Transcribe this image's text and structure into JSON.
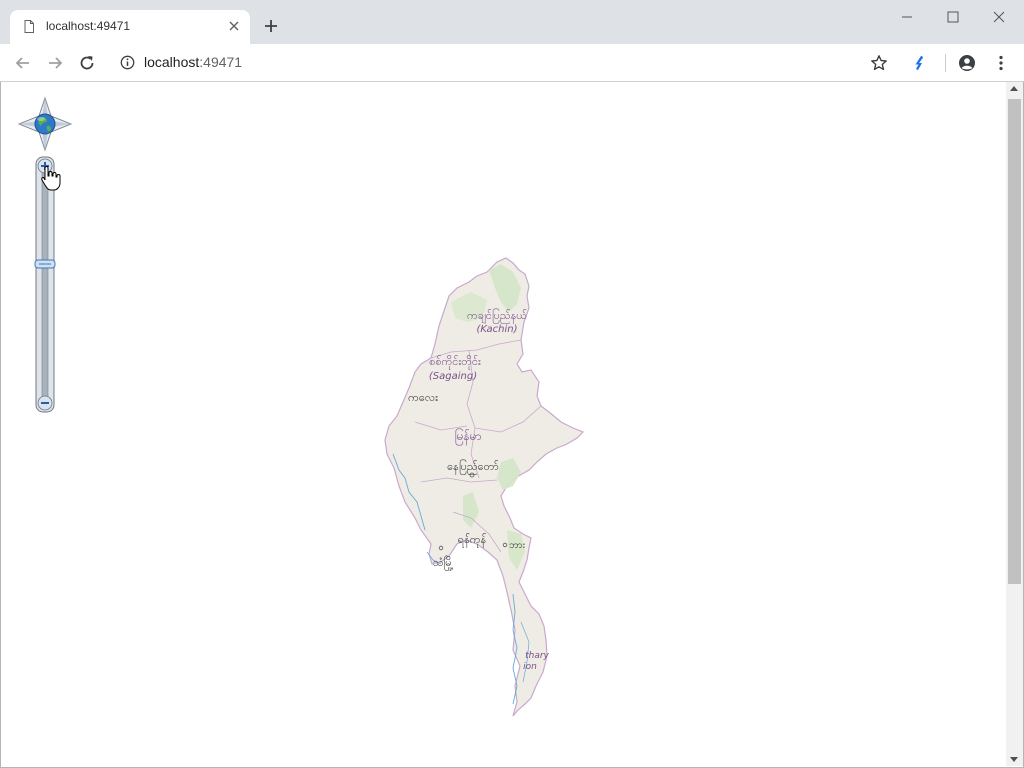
{
  "browser": {
    "tab_title": "localhost:49471",
    "url_host": "localhost",
    "url_port": ":49471"
  },
  "map": {
    "zoom_slider_level": 0.3,
    "labels": [
      {
        "text": "ကချင်ပြည်နယ်",
        "style": "region"
      },
      {
        "text": "(Kachin)",
        "style": "region-en"
      },
      {
        "text": "စစ်ကိုင်းတိုင်း",
        "style": "region"
      },
      {
        "text": "(Sagaing)",
        "style": "region-en"
      },
      {
        "text": "ကလေး",
        "style": "city"
      },
      {
        "text": "မြန်မာ",
        "style": "country"
      },
      {
        "text": "နေပြည်တော်",
        "style": "capital"
      },
      {
        "text": "ရန်ကုန်",
        "style": "city"
      },
      {
        "text": "ဘား",
        "style": "city"
      },
      {
        "text": "သံမြို့",
        "style": "city"
      },
      {
        "text": "thary",
        "style": "region-en"
      },
      {
        "text": "ion",
        "style": "region-en"
      }
    ],
    "colors": {
      "land": "#efece5",
      "border": "#c9a8cf",
      "forest": "#cfe3c2",
      "water": "#6aa9d6"
    }
  }
}
